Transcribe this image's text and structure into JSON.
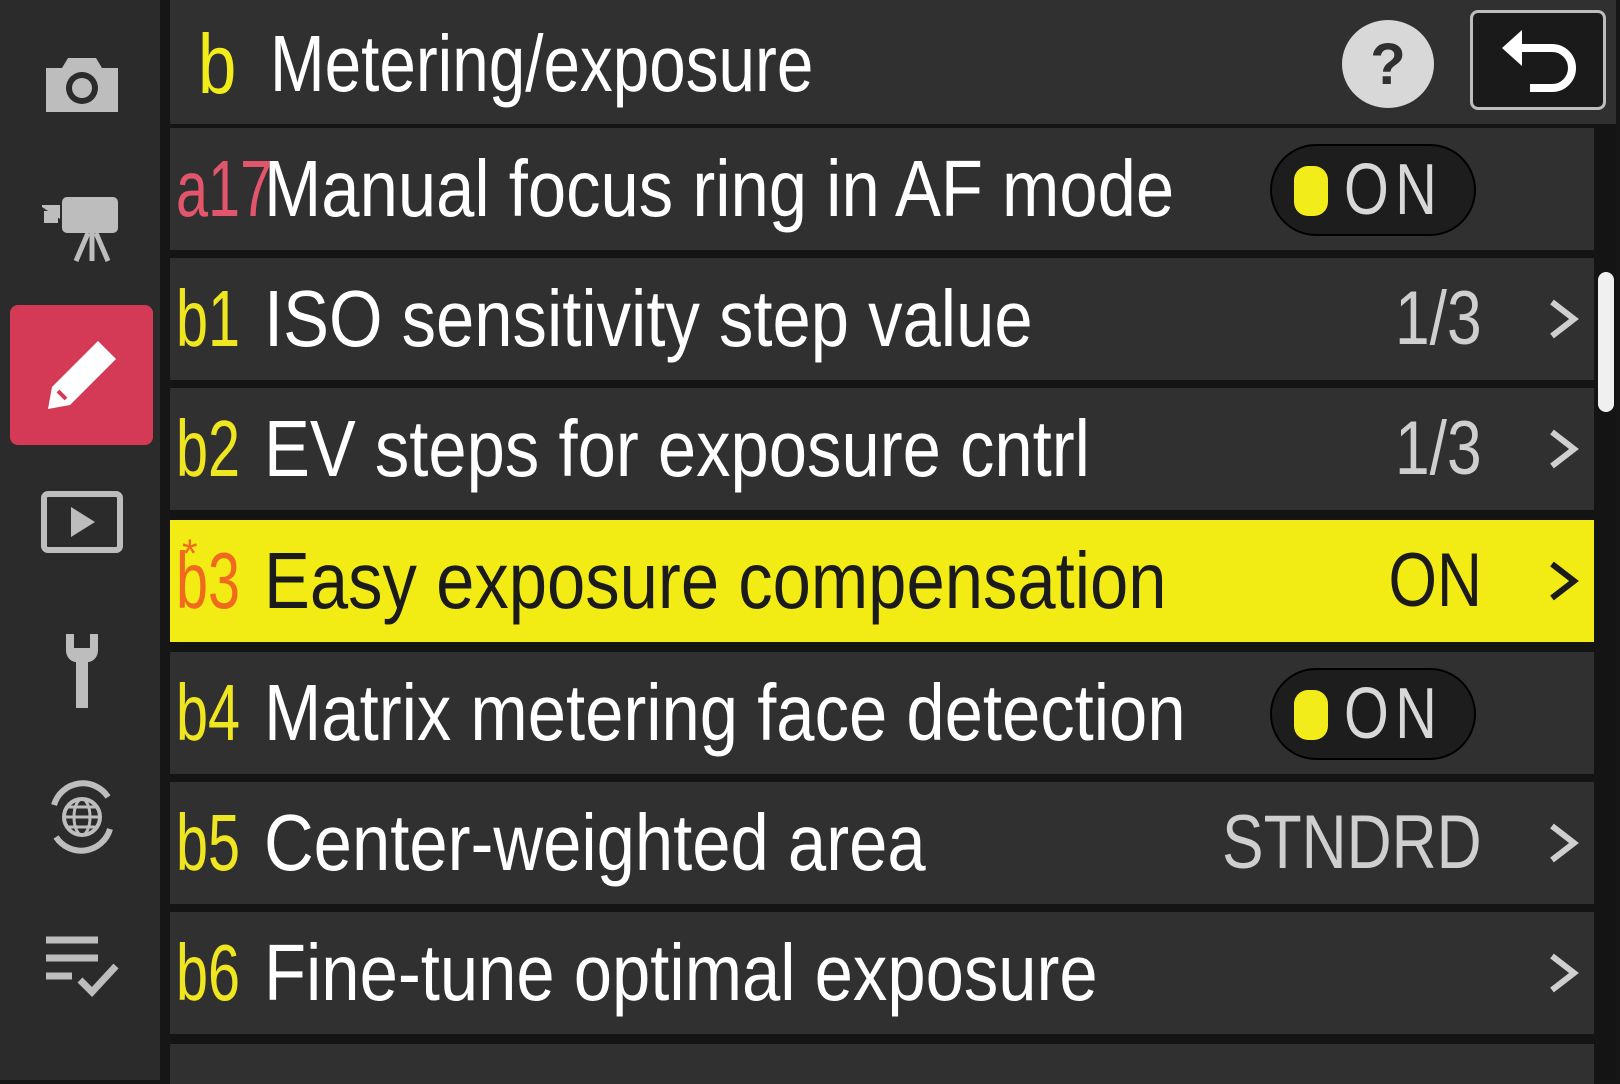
{
  "sidebar": {
    "items": [
      {
        "icon": "camera-icon",
        "active": false
      },
      {
        "icon": "movie-camera-icon",
        "active": false
      },
      {
        "icon": "pencil-icon",
        "active": true
      },
      {
        "icon": "playback-icon",
        "active": false
      },
      {
        "icon": "wrench-icon",
        "active": false
      },
      {
        "icon": "network-globe-icon",
        "active": false
      },
      {
        "icon": "my-menu-checklist-icon",
        "active": false
      }
    ]
  },
  "header": {
    "letter": "b",
    "title": "Metering/exposure",
    "help_label": "?",
    "back_icon": "return-arrow-icon"
  },
  "rows": [
    {
      "code": "a17",
      "label": "Manual focus ring in AF mode",
      "value": "ON",
      "control": "toggle"
    },
    {
      "code": "b1",
      "label": "ISO sensitivity step value",
      "value": "1/3",
      "control": "arrow"
    },
    {
      "code": "b2",
      "label": "EV steps for exposure cntrl",
      "value": "1/3",
      "control": "arrow"
    },
    {
      "code": "b3",
      "label": "Easy exposure compensation",
      "value": "ON",
      "control": "arrow",
      "selected": true,
      "modified": true
    },
    {
      "code": "b4",
      "label": "Matrix metering face detection",
      "value": "ON",
      "control": "toggle"
    },
    {
      "code": "b5",
      "label": "Center-weighted area",
      "value": "STNDRD",
      "control": "arrow"
    },
    {
      "code": "b6",
      "label": "Fine-tune optimal exposure",
      "value": "",
      "control": "arrow"
    }
  ],
  "colors": {
    "accent_yellow": "#f3ec14",
    "active_tab": "#d43a55",
    "modified_marker": "#ef6a1e",
    "group_a_code": "#e3556a"
  }
}
